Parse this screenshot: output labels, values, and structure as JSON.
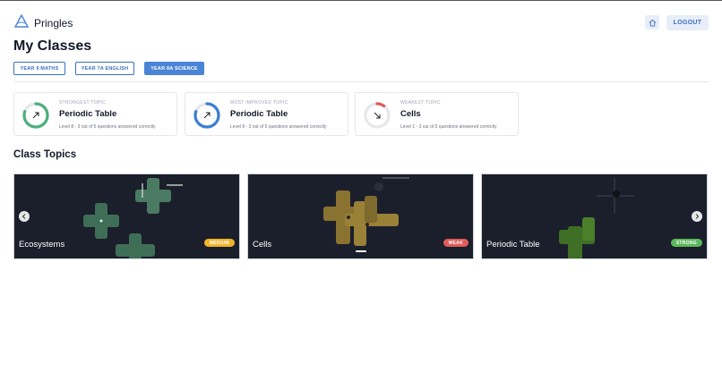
{
  "app": {
    "title": "Pringles"
  },
  "header": {
    "logout_label": "LOGOUT"
  },
  "page": {
    "title": "My Classes"
  },
  "classes": [
    {
      "label": "YEAR 9 MATHS",
      "active": false
    },
    {
      "label": "YEAR 7A ENGLISH",
      "active": false
    },
    {
      "label": "YEAR 8A SCIENCE",
      "active": true
    }
  ],
  "stats": [
    {
      "kicker": "STRONGEST TOPIC",
      "topic": "Periodic Table",
      "detail": "Level 8 - 3 out of 5 questions answered correctly",
      "progress": 0.8,
      "color": "#4caf7d",
      "icon": "arrow-up-right-icon"
    },
    {
      "kicker": "MOST IMPROVED TOPIC",
      "topic": "Periodic Table",
      "detail": "Level 8 - 3 out of 5 questions answered correctly",
      "progress": 0.8,
      "color": "#3b7fd1",
      "icon": "arrow-up-right-icon"
    },
    {
      "kicker": "WEAKEST TOPIC",
      "topic": "Cells",
      "detail": "Level 1 - 3 out of 5 questions answered correctly",
      "progress": 0.1,
      "color": "#e05a5a",
      "icon": "arrow-down-right-icon"
    }
  ],
  "section": {
    "title": "Class Topics"
  },
  "topics": [
    {
      "name": "Ecosystems",
      "badge": "MEDIUM",
      "badge_color": "#f0b429"
    },
    {
      "name": "Cells",
      "badge": "WEAK",
      "badge_color": "#e05a5a"
    },
    {
      "name": "Periodic Table",
      "badge": "STRONG",
      "badge_color": "#5cb85c"
    }
  ],
  "colors": {
    "accent": "#4a84d6",
    "track": "#e5e7eb"
  }
}
